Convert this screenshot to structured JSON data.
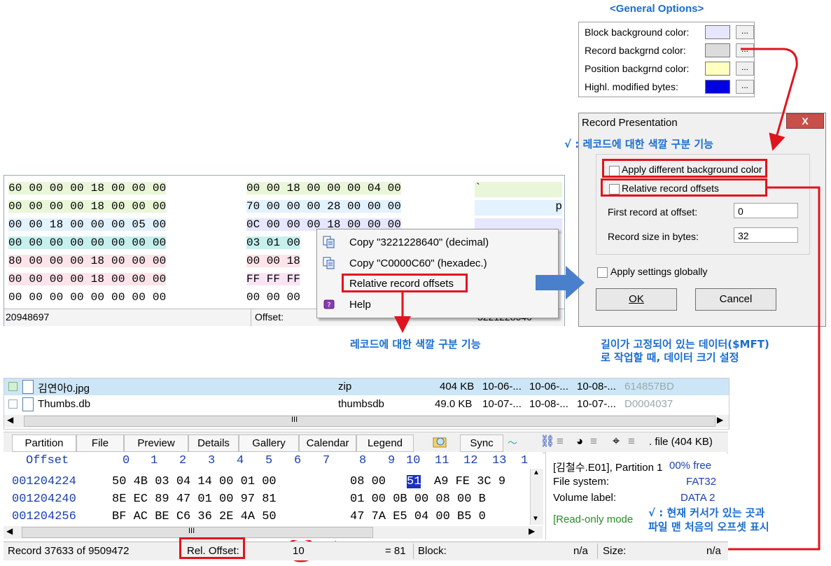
{
  "general_options": {
    "title": "<General Options>",
    "rows": [
      {
        "label": "Block background color:",
        "color": "#e6e6ff",
        "button": "..."
      },
      {
        "label": "Record backgrnd color:",
        "color": "#dcdcdc",
        "button": "..."
      },
      {
        "label": "Position backgrnd color:",
        "color": "#ffffc0",
        "button": "..."
      },
      {
        "label": "Highl. modified bytes:",
        "color": "#0000e0",
        "button": "..."
      }
    ]
  },
  "dialog": {
    "title": "Record Presentation",
    "close": "X",
    "apply_bg": "Apply different background color",
    "relative_offsets": "Relative record offsets",
    "first_record_label": "First record at offset:",
    "first_record_value": "0",
    "record_size_label": "Record size in bytes:",
    "record_size_value": "32",
    "apply_globally": "Apply settings globally",
    "ok": "OK",
    "cancel": "Cancel"
  },
  "annotations": {
    "color_feature": "√ : 레코드에 대한 색깔 구분 기능",
    "color_feature_menu": "레코드에 대한 색깔 구분 기능",
    "fixed_length_1": "길이가 고정되어 있는 데이터($MFT)",
    "fixed_length_2": "로 작업할 때, 데이터 크기 설정",
    "cursor_1": "√ : 현재 커서가 있는 곳과",
    "cursor_2": "파일 맨 처음의 오프셋 표시"
  },
  "hex_top": {
    "rows": [
      {
        "a": "60 00 00 00 18 00 00 00",
        "b": "00 00 18 00 00 00 04 00",
        "c": "`",
        "color": "#eaf6d8"
      },
      {
        "a": "00 00 00 00 18 00 00 00",
        "b": "70 00 00 00 28 00 00 00",
        "c": "p",
        "color": "#e2f2ff"
      },
      {
        "a": "00 00 18 00 00 00 05 00",
        "b": "0C 00 00 00 18 00 00 00",
        "c": "",
        "color": "#e6e6ff"
      },
      {
        "a": "00 00 00 00 00 00 00 00",
        "b": "03 01 00",
        "c": "",
        "color": "#c6f0ee"
      },
      {
        "a": "80 00 00 00 18 00 00 00",
        "b": "00 00 18",
        "c": "",
        "color": "#fde4ea"
      },
      {
        "a": "00 00 00 00 18 00 00 00",
        "b": "FF FF FF",
        "c": "",
        "color": "#f9e4f6"
      },
      {
        "a": "00 00 00 00 00 00 00 00",
        "b": "00 00 00",
        "c": "",
        "color": "#ffffff"
      }
    ],
    "status_left": "20948697",
    "status_offset": "Offset:",
    "status_right": "3221228640"
  },
  "context_menu": {
    "items": [
      "Copy \"3221228640\" (decimal)",
      "Copy \"C0000C60\" (hexadec.)",
      "Relative record offsets",
      "Help"
    ]
  },
  "file_list": {
    "rows": [
      {
        "name": "김연아0.jpg",
        "type": "zip",
        "size": "404 KB",
        "d1": "10-06-...",
        "d2": "10-06-...",
        "d3": "10-08-...",
        "hash": "614857BD"
      },
      {
        "name": "Thumbs.db",
        "type": "thumbsdb",
        "size": "49.0 KB",
        "d1": "10-07-...",
        "d2": "10-08-...",
        "d3": "10-07-...",
        "hash": "D0004037"
      }
    ],
    "scroll_mark": "III"
  },
  "tabs": [
    "Partition",
    "File",
    "Preview",
    "Details",
    "Gallery",
    "Calendar",
    "Legend"
  ],
  "toolbar": {
    "sync": "Sync",
    "file_info": ". file (404 KB)"
  },
  "hex_bottom": {
    "offset_header": "Offset",
    "col_headers": [
      "0",
      "1",
      "2",
      "3",
      "4",
      "5",
      "6",
      "7",
      "8",
      "9",
      "10",
      "11",
      "12",
      "13",
      "1"
    ],
    "rows": [
      {
        "offset": "001204224",
        "a": "50 4B 03 04 14 00 01 00",
        "b": "08 00",
        "sel": "51",
        "c": "A9 FE 3C 9"
      },
      {
        "offset": "001204240",
        "a": "8E EC 89 47 01 00 97 81",
        "b": "01 00 0B 00 08 00 B",
        "sel": "",
        "c": ""
      },
      {
        "offset": "001204256",
        "a": "BF AC BE C6 36 2E 4A 50",
        "b": "47 7A E5 04 00 B5 0",
        "sel": "",
        "c": ""
      }
    ],
    "scroll_mark": "III"
  },
  "side": {
    "l1": "[김철수.E01], Partition 1",
    "r1": "00% free",
    "l2": "File system:",
    "r2": "FAT32",
    "l3": "Volume label:",
    "r3": "DATA 2",
    "l4": "[Read-only mode"
  },
  "status": {
    "record": "Record 37633 of 9509472",
    "rel": "Rel. Offset:",
    "rel_val": "10",
    "num": "= 81",
    "block": "Block:",
    "na1": "n/a",
    "size": "Size:",
    "na2": "n/a"
  }
}
